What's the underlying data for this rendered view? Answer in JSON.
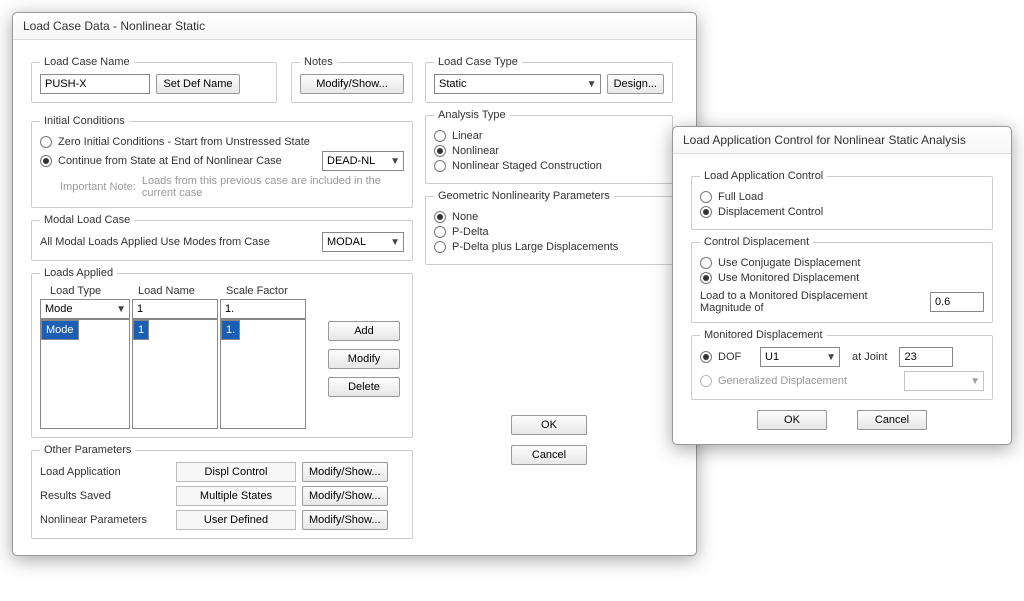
{
  "main": {
    "title": "Load Case Data - Nonlinear Static",
    "loadCaseName": {
      "legend": "Load Case Name",
      "value": "PUSH-X",
      "setDef": "Set Def Name"
    },
    "notes": {
      "legend": "Notes",
      "btn": "Modify/Show..."
    },
    "loadCaseType": {
      "legend": "Load Case Type",
      "value": "Static",
      "design": "Design..."
    },
    "initial": {
      "legend": "Initial Conditions",
      "opt1": "Zero Initial Conditions - Start from Unstressed State",
      "opt2": "Continue from State at End of Nonlinear Case",
      "case": "DEAD-NL",
      "noteLabel": "Important Note:",
      "noteText": "Loads from this previous case are included in the current case"
    },
    "analysis": {
      "legend": "Analysis Type",
      "opt1": "Linear",
      "opt2": "Nonlinear",
      "opt3": "Nonlinear Staged Construction"
    },
    "modal": {
      "legend": "Modal Load Case",
      "text": "All Modal Loads Applied Use Modes from Case",
      "value": "MODAL"
    },
    "geo": {
      "legend": "Geometric Nonlinearity Parameters",
      "opt1": "None",
      "opt2": "P-Delta",
      "opt3": "P-Delta plus Large Displacements"
    },
    "loads": {
      "legend": "Loads Applied",
      "headers": {
        "type": "Load Type",
        "name": "Load Name",
        "scale": "Scale Factor"
      },
      "editor": {
        "type": "Mode",
        "name": "1",
        "scale": "1."
      },
      "rows": [
        {
          "type": "Mode",
          "name": "1",
          "scale": "1."
        }
      ],
      "add": "Add",
      "modify": "Modify",
      "delete": "Delete"
    },
    "other": {
      "legend": "Other Parameters",
      "rows": [
        {
          "label": "Load Application",
          "value": "Displ Control",
          "btn": "Modify/Show..."
        },
        {
          "label": "Results Saved",
          "value": "Multiple States",
          "btn": "Modify/Show..."
        },
        {
          "label": "Nonlinear Parameters",
          "value": "User Defined",
          "btn": "Modify/Show..."
        }
      ]
    },
    "ok": "OK",
    "cancel": "Cancel"
  },
  "lac": {
    "title": "Load Application Control for Nonlinear Static Analysis",
    "appCtrl": {
      "legend": "Load Application Control",
      "opt1": "Full Load",
      "opt2": "Displacement Control"
    },
    "ctrlDisp": {
      "legend": "Control Displacement",
      "opt1": "Use Conjugate Displacement",
      "opt2": "Use Monitored Displacement",
      "magLabel": "Load to a Monitored Displacement Magnitude of",
      "magValue": "0.6"
    },
    "monDisp": {
      "legend": "Monitored Displacement",
      "opt1": "DOF",
      "dof": "U1",
      "atJoint": "at Joint",
      "joint": "23",
      "opt2": "Generalized Displacement"
    },
    "ok": "OK",
    "cancel": "Cancel"
  }
}
